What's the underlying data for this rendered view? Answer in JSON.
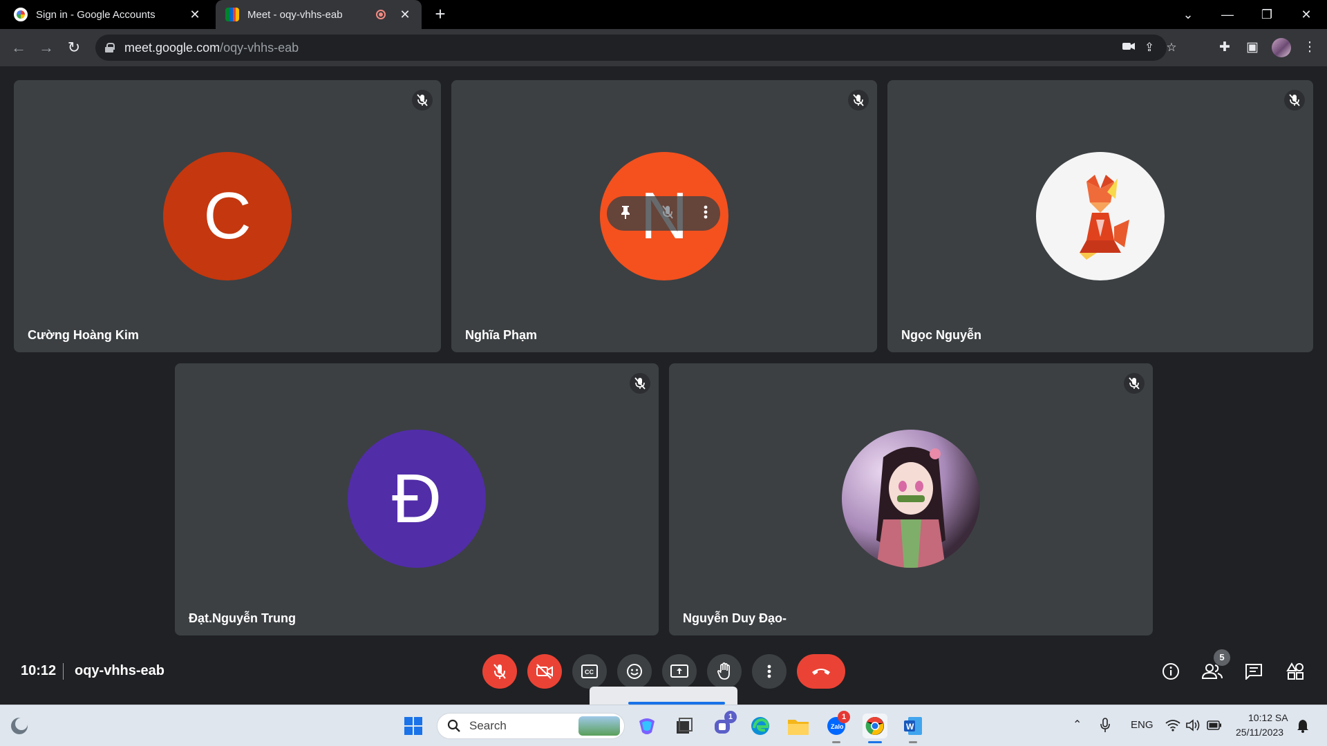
{
  "browser": {
    "tabs": [
      {
        "title": "Sign in - Google Accounts",
        "active": false
      },
      {
        "title": "Meet - oqy-vhhs-eab",
        "active": true,
        "recording": true
      }
    ],
    "new_tab_label": "+",
    "url": {
      "host": "meet.google.com",
      "path": "/oqy-vhhs-eab"
    }
  },
  "meeting": {
    "time": "10:12",
    "code": "oqy-vhhs-eab",
    "participants_count": "5",
    "participants": [
      {
        "name": "Cường Hoàng Kim",
        "initial": "C",
        "avatar_color": "#c5370e",
        "muted": true
      },
      {
        "name": "Nghĩa Phạm",
        "initial": "N",
        "avatar_color": "#f4511e",
        "muted": true,
        "hovered": true
      },
      {
        "name": "Ngọc Nguyễn",
        "initial": "",
        "avatar_type": "fox-image",
        "muted": true
      },
      {
        "name": "Đạt.Nguyễn Trung",
        "initial": "Đ",
        "avatar_color": "#512da8",
        "muted": true
      },
      {
        "name": "Nguyễn Duy Đạo-",
        "initial": "",
        "avatar_type": "anime-image",
        "muted": true
      }
    ],
    "controls": [
      "mic-off",
      "camera-off",
      "captions",
      "emoji",
      "present",
      "raise-hand",
      "more",
      "leave-call"
    ],
    "right_controls": [
      "info",
      "people",
      "chat",
      "activities"
    ]
  },
  "taskbar": {
    "search_label": "Search",
    "badges": {
      "teams": "1",
      "zalo": "1"
    },
    "tray": {
      "language": "ENG",
      "time": "10:12 SA",
      "date": "25/11/2023"
    }
  },
  "colors": {
    "accent_red": "#ea4335",
    "tile_bg": "#3c4043",
    "page_bg": "#202124"
  }
}
